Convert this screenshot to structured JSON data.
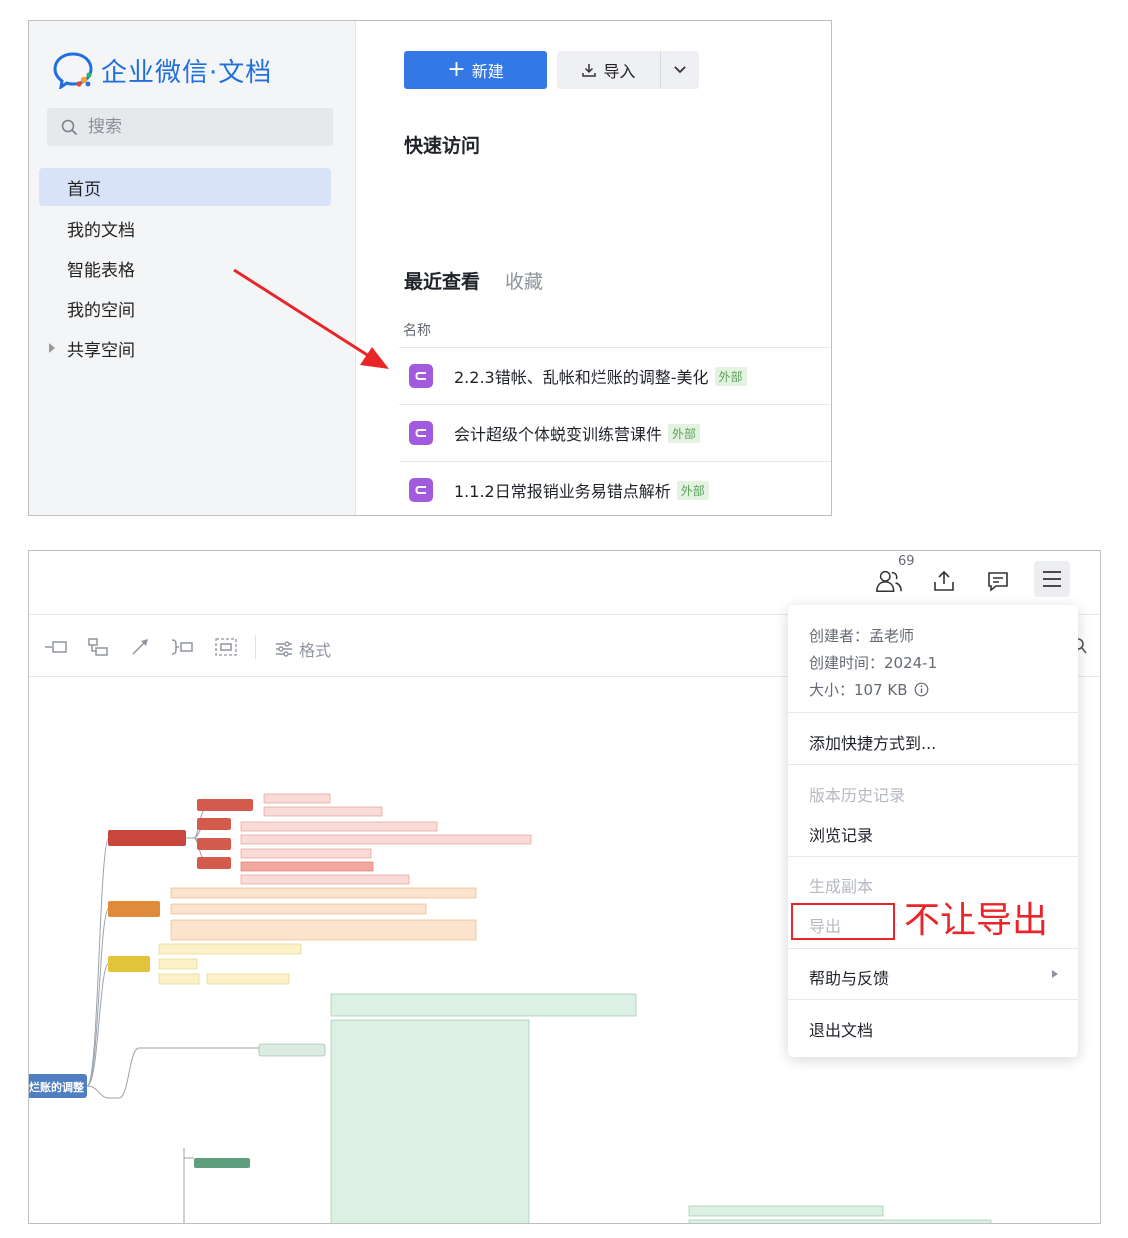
{
  "panel1": {
    "logo_text": "企业微信·文档",
    "search_placeholder": "搜索",
    "nav": [
      "首页",
      "我的文档",
      "智能表格",
      "我的空间",
      "共享空间"
    ],
    "btn_new": "新建",
    "btn_import": "导入",
    "quick_access": "快速访问",
    "recent": "最近查看",
    "favorites": "收藏",
    "col_name": "名称",
    "files": [
      {
        "name": "2.2.3错帐、乱帐和烂账的调整-美化",
        "tag": "外部"
      },
      {
        "name": "会计超级个体蜕变训练营课件",
        "tag": "外部"
      },
      {
        "name": "1.1.2日常报销业务易错点解析",
        "tag": "外部"
      }
    ]
  },
  "panel2": {
    "collab_count": "69",
    "format_label": "格式",
    "menu": {
      "creator": "创建者：孟老师",
      "created": "创建时间：2024-1",
      "size": "大小：107 KB",
      "add_shortcut": "添加快捷方式到...",
      "version_history": "版本历史记录",
      "browse_history": "浏览记录",
      "make_copy": "生成副本",
      "export": "导出",
      "help": "帮助与反馈",
      "exit": "退出文档"
    },
    "annotation": "不让导出",
    "mindmap_root": "烂账的调整",
    "colors": {
      "accent": "#3478e5",
      "annotation": "#e8262a",
      "file_icon": "#a35bdd"
    }
  }
}
